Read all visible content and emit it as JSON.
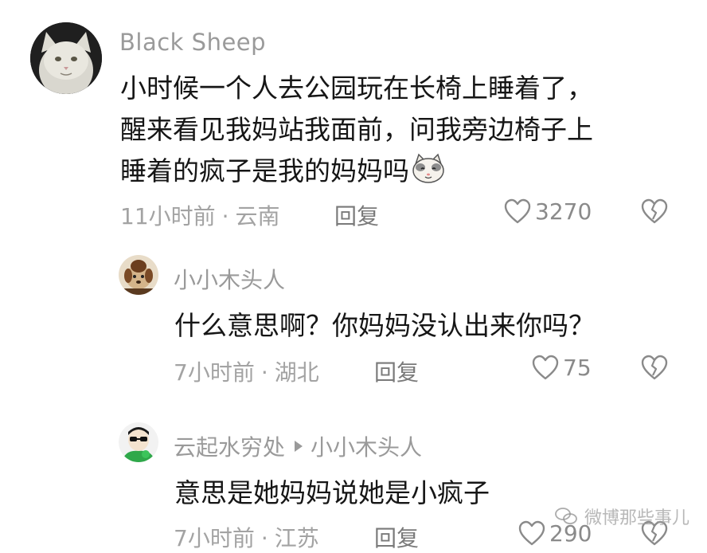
{
  "comments": [
    {
      "username": "Black Sheep",
      "text_lines": [
        "小时候一个人去公园玩在长椅上睡着了，",
        "醒来看见我妈站我面前，问我旁边椅子上",
        "睡着的疯子是我的妈妈吗"
      ],
      "time": "11小时前",
      "location": "云南",
      "reply_label": "回复",
      "likes": "3270",
      "avatar_icon": "white-cat-avatar-icon",
      "emoji_icon": "cat-face-emoji-icon"
    },
    {
      "username": "小小木头人",
      "text": "什么意思啊？你妈妈没认出来你吗？",
      "time": "7小时前",
      "location": "湖北",
      "reply_label": "回复",
      "likes": "75",
      "avatar_icon": "cartoon-dog-avatar-icon"
    },
    {
      "username": "云起水穷处",
      "reply_to": "小小木头人",
      "text": "意思是她妈妈说她是小疯子",
      "time": "7小时前",
      "location": "江苏",
      "reply_label": "回复",
      "likes": "290",
      "avatar_icon": "green-cartoon-avatar-icon"
    }
  ],
  "separator": "·",
  "watermark": "微博那些事儿",
  "colors": {
    "text": "#161616",
    "secondary": "#9a9a9a",
    "background": "#ffffff"
  }
}
